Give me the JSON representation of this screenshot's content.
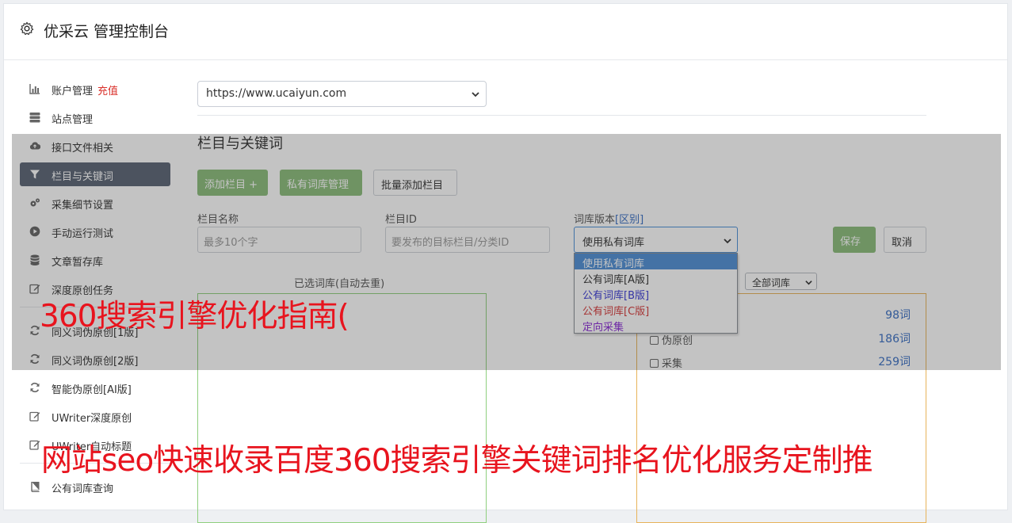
{
  "header": {
    "title": "优采云 管理控制台"
  },
  "sidebar": {
    "items": [
      {
        "label": "账户管理",
        "extra": "充值",
        "icon": "bar-chart-icon"
      },
      {
        "label": "站点管理",
        "icon": "server-icon"
      },
      {
        "label": "接口文件相关",
        "icon": "cloud-upload-icon"
      },
      {
        "label": "栏目与关键词",
        "icon": "filter-icon",
        "active": true
      },
      {
        "label": "采集细节设置",
        "icon": "gears-icon"
      },
      {
        "label": "手动运行测试",
        "icon": "play-circle-icon"
      },
      {
        "label": "文章暂存库",
        "icon": "database-icon"
      },
      {
        "label": "深度原创任务",
        "icon": "edit-icon"
      },
      {
        "label": "同义词伪原创[1版]",
        "icon": "refresh-icon"
      },
      {
        "label": "同义词伪原创[2版]",
        "icon": "refresh-icon"
      },
      {
        "label": "智能伪原创[AI版]",
        "icon": "refresh-icon"
      },
      {
        "label": "UWriter深度原创",
        "icon": "edit-icon"
      },
      {
        "label": "UWriter自动标题",
        "icon": "edit-icon"
      },
      {
        "label": "公有词库查询",
        "icon": "book-icon"
      }
    ]
  },
  "main": {
    "site_select": "https://www.ucaiyun.com",
    "section_title": "栏目与关键词",
    "buttons": {
      "add_column": "添加栏目 +",
      "private_lexicon": "私有词库管理",
      "batch_add": "批量添加栏目"
    },
    "form": {
      "column_name_label": "栏目名称",
      "column_name_placeholder": "最多10个字",
      "column_id_label": "栏目ID",
      "column_id_placeholder": "要发布的目标栏目/分类ID",
      "lexicon_version_label": "词库版本",
      "lexicon_version_link": "[区别]",
      "lexicon_version_value": "使用私有词库",
      "save": "保存",
      "cancel": "取消"
    },
    "lexicon_options": [
      {
        "label": "使用私有词库",
        "color": "#ffffff",
        "selected": true
      },
      {
        "label": "公有词库[A版]",
        "color": "#333333"
      },
      {
        "label": "公有词库[B版]",
        "color": "#3a3ad6"
      },
      {
        "label": "公有词库[C版]",
        "color": "#d63a3a"
      },
      {
        "label": "定向采集",
        "color": "#8a2ad6"
      }
    ],
    "selected_panel_title": "已选词库(自动去重)",
    "filter_select": "全部词库",
    "word_rows": [
      {
        "label": "",
        "count": "98词"
      },
      {
        "label": "伪原创",
        "count": "186词"
      },
      {
        "label": "采集",
        "count": "259词"
      }
    ]
  },
  "overlay": {
    "line1": "360搜索引擎优化指南(",
    "line2": "网站seo快速收录百度360搜索引擎关键词排名优化服务定制推"
  }
}
